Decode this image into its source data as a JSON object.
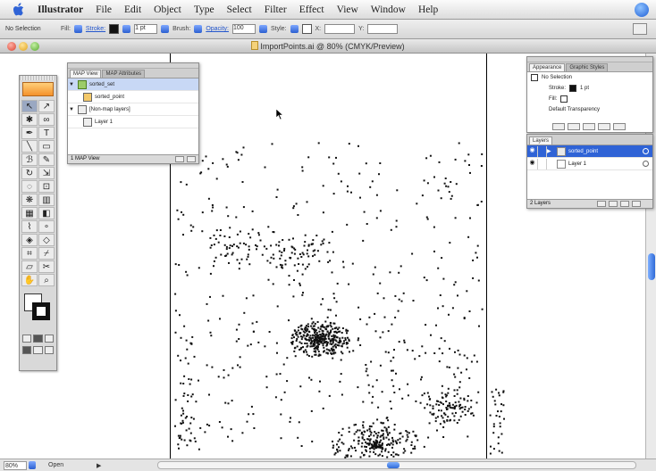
{
  "menubar": {
    "app": "Illustrator",
    "items": [
      "File",
      "Edit",
      "Object",
      "Type",
      "Select",
      "Filter",
      "Effect",
      "View",
      "Window",
      "Help"
    ]
  },
  "controlbar": {
    "selection": "No Selection",
    "fill_label": "Fill:",
    "stroke_label": "Stroke:",
    "stroke_weight": "1 pt",
    "brush_label": "Brush:",
    "opacity_label": "Opacity:",
    "opacity_value": "100",
    "style_label": "Style:",
    "x_label": "X:",
    "y_label": "Y:"
  },
  "document": {
    "title": "ImportPoints.ai @ 80% (CMYK/Preview)"
  },
  "statusbar": {
    "zoom": "80%",
    "text": "Open"
  },
  "navigator": {
    "tabs": [
      "MAP View",
      "MAP Attributes"
    ],
    "rows": [
      "sorted_set",
      "sorted_point",
      "[Non-map layers]",
      "Layer 1"
    ],
    "footer": "1 MAP View"
  },
  "appearance": {
    "tabs": [
      "Appearance",
      "Graphic Styles"
    ],
    "title": "No Selection",
    "stroke_label": "Stroke:",
    "stroke_value": "1 pt",
    "fill_label": "Fill:",
    "transparency": "Default Transparency"
  },
  "layers": {
    "tab": "Layers",
    "rows": [
      "sorted_point",
      "Layer 1"
    ],
    "footer": "2 Layers"
  },
  "colors": {
    "selection_blue": "#2f63d6",
    "accent_orange": "#f4922b"
  }
}
